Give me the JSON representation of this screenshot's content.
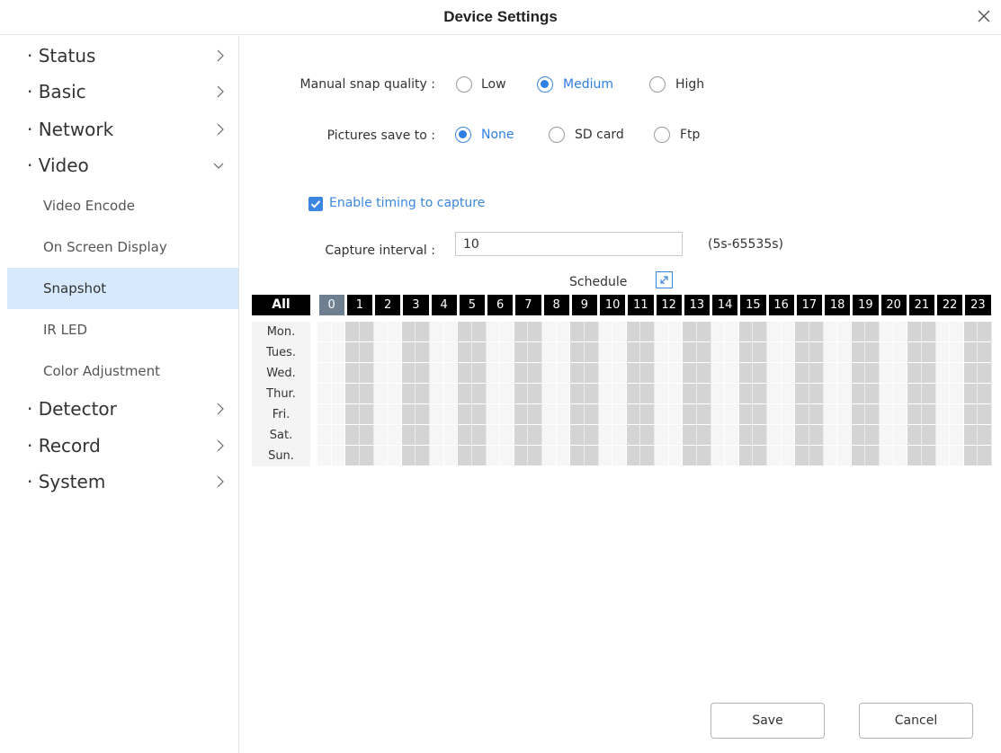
{
  "window": {
    "title": "Device Settings"
  },
  "sidebar": {
    "top_items": [
      {
        "label": "· Status"
      },
      {
        "label": "· Basic"
      },
      {
        "label": "· Network"
      },
      {
        "label": "· Video"
      },
      {
        "label": "· Detector"
      },
      {
        "label": "· Record"
      },
      {
        "label": "· System"
      }
    ],
    "video_sub_items": [
      {
        "label": "Video Encode"
      },
      {
        "label": "On Screen Display"
      },
      {
        "label": "Snapshot",
        "active": true
      },
      {
        "label": "IR LED"
      },
      {
        "label": "Color Adjustment"
      }
    ]
  },
  "snap_quality": {
    "label": "Manual snap quality :",
    "options": [
      "Low",
      "Medium",
      "High"
    ],
    "selected": "Medium"
  },
  "save_to": {
    "label": "Pictures save to :",
    "options": [
      "None",
      "SD card",
      "Ftp"
    ],
    "selected": "None"
  },
  "timing": {
    "label": "Enable timing to capture",
    "checked": true
  },
  "interval": {
    "label": "Capture interval :",
    "value": "10",
    "hint": "(5s-65535s)"
  },
  "schedule": {
    "title": "Schedule",
    "all_label": "All",
    "hours": [
      "0",
      "1",
      "2",
      "3",
      "4",
      "5",
      "6",
      "7",
      "8",
      "9",
      "10",
      "11",
      "12",
      "13",
      "14",
      "15",
      "16",
      "17",
      "18",
      "19",
      "20",
      "21",
      "22",
      "23"
    ],
    "days": [
      "Mon.",
      "Tues.",
      "Wed.",
      "Thur.",
      "Fri.",
      "Sat.",
      "Sun."
    ]
  },
  "buttons": {
    "save": "Save",
    "cancel": "Cancel"
  },
  "colors": {
    "accent": "#2f7fe3",
    "active_bg": "#d7e9fc",
    "hour_bg": "#000000",
    "hour_first_bg": "#6d7f91"
  }
}
